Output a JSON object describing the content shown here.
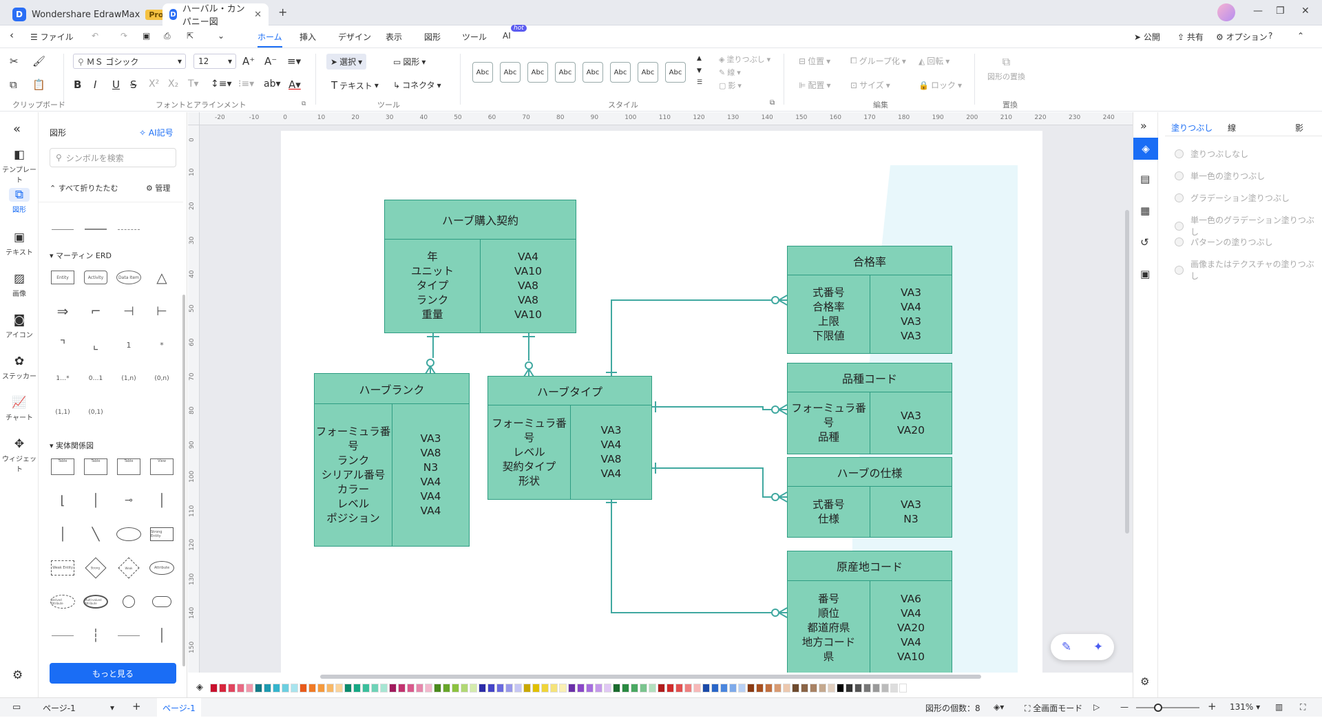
{
  "app": {
    "name": "Wondershare EdrawMax",
    "pro_badge": "Pro",
    "doc_tab": "ハーバル・カンパニー図"
  },
  "menu": {
    "items": [
      "ファイル",
      "ホーム",
      "挿入",
      "デザイン",
      "表示",
      "図形",
      "ツール",
      "AI"
    ],
    "hot": "hot",
    "right": [
      "公開",
      "共有",
      "オプション"
    ]
  },
  "ribbon": {
    "font_name": "ＭＳ ゴシック",
    "font_size": "12",
    "select_label": "選択",
    "shape_label": "図形",
    "text_label": "テキスト",
    "connector_label": "コネクタ",
    "style_abc": [
      "Abc",
      "Abc",
      "Abc",
      "Abc",
      "Abc",
      "Abc",
      "Abc",
      "Abc"
    ],
    "fill_label": "塗りつぶし",
    "line_label": "線",
    "shadow_label": "影",
    "position_label": "位置",
    "group_label": "グループ化",
    "rotate_label": "回転",
    "align_label": "配置",
    "size_label": "サイズ",
    "lock_label": "ロック",
    "replace_label": "図形の置換",
    "groups": [
      "クリップボード",
      "フォントとアラインメント",
      "ツール",
      "スタイル",
      "編集",
      "置換"
    ]
  },
  "leftnav": [
    "テンプレート",
    "図形",
    "テキスト",
    "画像",
    "アイコン",
    "ステッカー",
    "チャート",
    "ウィジェット"
  ],
  "library": {
    "title": "図形",
    "ai_label": "AI記号",
    "search_placeholder": "シンボルを検索",
    "collapse_all": "すべて折りたたむ",
    "manage": "管理",
    "section1": "マーティン ERD",
    "section2": "実体関係図",
    "more_button": "もっと見る",
    "martin_texts": [
      "Entity",
      "Activity",
      "Data Item",
      "1",
      "*",
      "1…*",
      "0…1",
      "(1,n)",
      "(0,n)",
      "(1,1)",
      "(0,1)"
    ],
    "er_texts": [
      "Table",
      "Table",
      "Table",
      "View",
      "Strong Entity",
      "Weak Entity",
      "Strong",
      "Weak",
      "Attribute",
      "Derived Attribute",
      "Multi-valued Attribute"
    ]
  },
  "ruler": {
    "h": [
      "-20",
      "-10",
      "0",
      "10",
      "20",
      "30",
      "40",
      "50",
      "60",
      "70",
      "80",
      "90",
      "100",
      "110",
      "120",
      "130",
      "140",
      "150",
      "160",
      "170",
      "180",
      "190",
      "200",
      "210",
      "220",
      "230",
      "240"
    ],
    "v": [
      "0",
      "10",
      "20",
      "30",
      "40",
      "50",
      "60",
      "70",
      "80",
      "90",
      "100",
      "110",
      "120",
      "130",
      "140",
      "150"
    ]
  },
  "entities": [
    {
      "id": "contract",
      "title": "ハーブ購入契約",
      "left": "年\nユニット\nタイプ\nランク\n重量",
      "right": "VA4\nVA10\nVA8\nVA8\nVA10"
    },
    {
      "id": "rank",
      "title": "ハーブランク",
      "left": "フォーミュラ番\n号\nランク\nシリアル番号\nカラー\nレベル\nポジション",
      "right": "VA3\nVA8\nN3\nVA4\nVA4\nVA4"
    },
    {
      "id": "type",
      "title": "ハーブタイプ",
      "left": "フォーミュラ番\n号\nレベル\n契約タイプ\n形状",
      "right": "VA3\nVA4\nVA8\nVA4"
    },
    {
      "id": "pass",
      "title": "合格率",
      "left": "式番号\n合格率\n上限\n下限値",
      "right": "VA3\nVA4\nVA3\nVA3"
    },
    {
      "id": "variety",
      "title": "品種コード",
      "left": "フォーミュラ番\n号\n品種",
      "right": "VA3\nVA20"
    },
    {
      "id": "spec",
      "title": "ハーブの仕様",
      "left": "式番号\n仕様",
      "right": "VA3\nN3"
    },
    {
      "id": "origin",
      "title": "原産地コード",
      "left": "番号\n順位\n都道府県\n地方コード\n県",
      "right": "VA6\nVA4\nVA20\nVA4\nVA10"
    }
  ],
  "fill_panel": {
    "tabs": [
      "塗りつぶし",
      "線",
      "影"
    ],
    "options": [
      "塗りつぶしなし",
      "単一色の塗りつぶし",
      "グラデーション塗りつぶし",
      "単一色のグラデーション塗りつぶし",
      "パターンの塗りつぶし",
      "画像またはテクスチャの塗りつぶし"
    ]
  },
  "status": {
    "page_select": "ページ-1",
    "page_tab": "ページ-1",
    "shape_count": "図形の個数：8",
    "fullscreen": "全画面モード",
    "zoom": "131%"
  },
  "colors": {
    "accent": "#1a6df5",
    "entity_fill": "#82d2b8",
    "entity_border": "#2e9c82",
    "connector": "#40a8a0"
  },
  "palette": [
    "#c8102e",
    "#d7263d",
    "#e0455e",
    "#e86a84",
    "#f197ab",
    "#127a87",
    "#1e9ab0",
    "#36b5cd",
    "#6ccfe0",
    "#a8e4ee",
    "#e85a1b",
    "#f07a26",
    "#f59a3d",
    "#f8b866",
    "#fbd39a",
    "#0b8a6c",
    "#17a884",
    "#3bbf9c",
    "#6fd3b7",
    "#a6e6d3",
    "#a01a5c",
    "#c2336f",
    "#d95a8c",
    "#e687ab",
    "#f2b8cd",
    "#4a8a1c",
    "#68a62a",
    "#8cc240",
    "#b1d874",
    "#d4ebac",
    "#2c2ca8",
    "#4545c8",
    "#6a6ade",
    "#9898ea",
    "#c6c6f4",
    "#c9a800",
    "#e0c000",
    "#f0d53a",
    "#f5e37a",
    "#f9efb4",
    "#6a2fa8",
    "#8a47c8",
    "#a66ede",
    "#c498ea",
    "#e0c8f4",
    "#1a6b2e",
    "#2a8a42",
    "#4aa862",
    "#7ac48e",
    "#b2dfbe",
    "#b01c1c",
    "#d02c2c",
    "#e25050",
    "#ee8080",
    "#f7b8b8",
    "#1a4aa8",
    "#2a66c8",
    "#4a86de",
    "#7eaaea",
    "#b8d0f4",
    "#8a3a12",
    "#a85020",
    "#c27040",
    "#d89a72",
    "#ecc8ae",
    "#6e4a2e",
    "#8a6446",
    "#a88264",
    "#c4a88e",
    "#e0cebe",
    "#000000",
    "#333333",
    "#555555",
    "#777777",
    "#999999",
    "#bbbbbb",
    "#dddddd",
    "#ffffff"
  ]
}
